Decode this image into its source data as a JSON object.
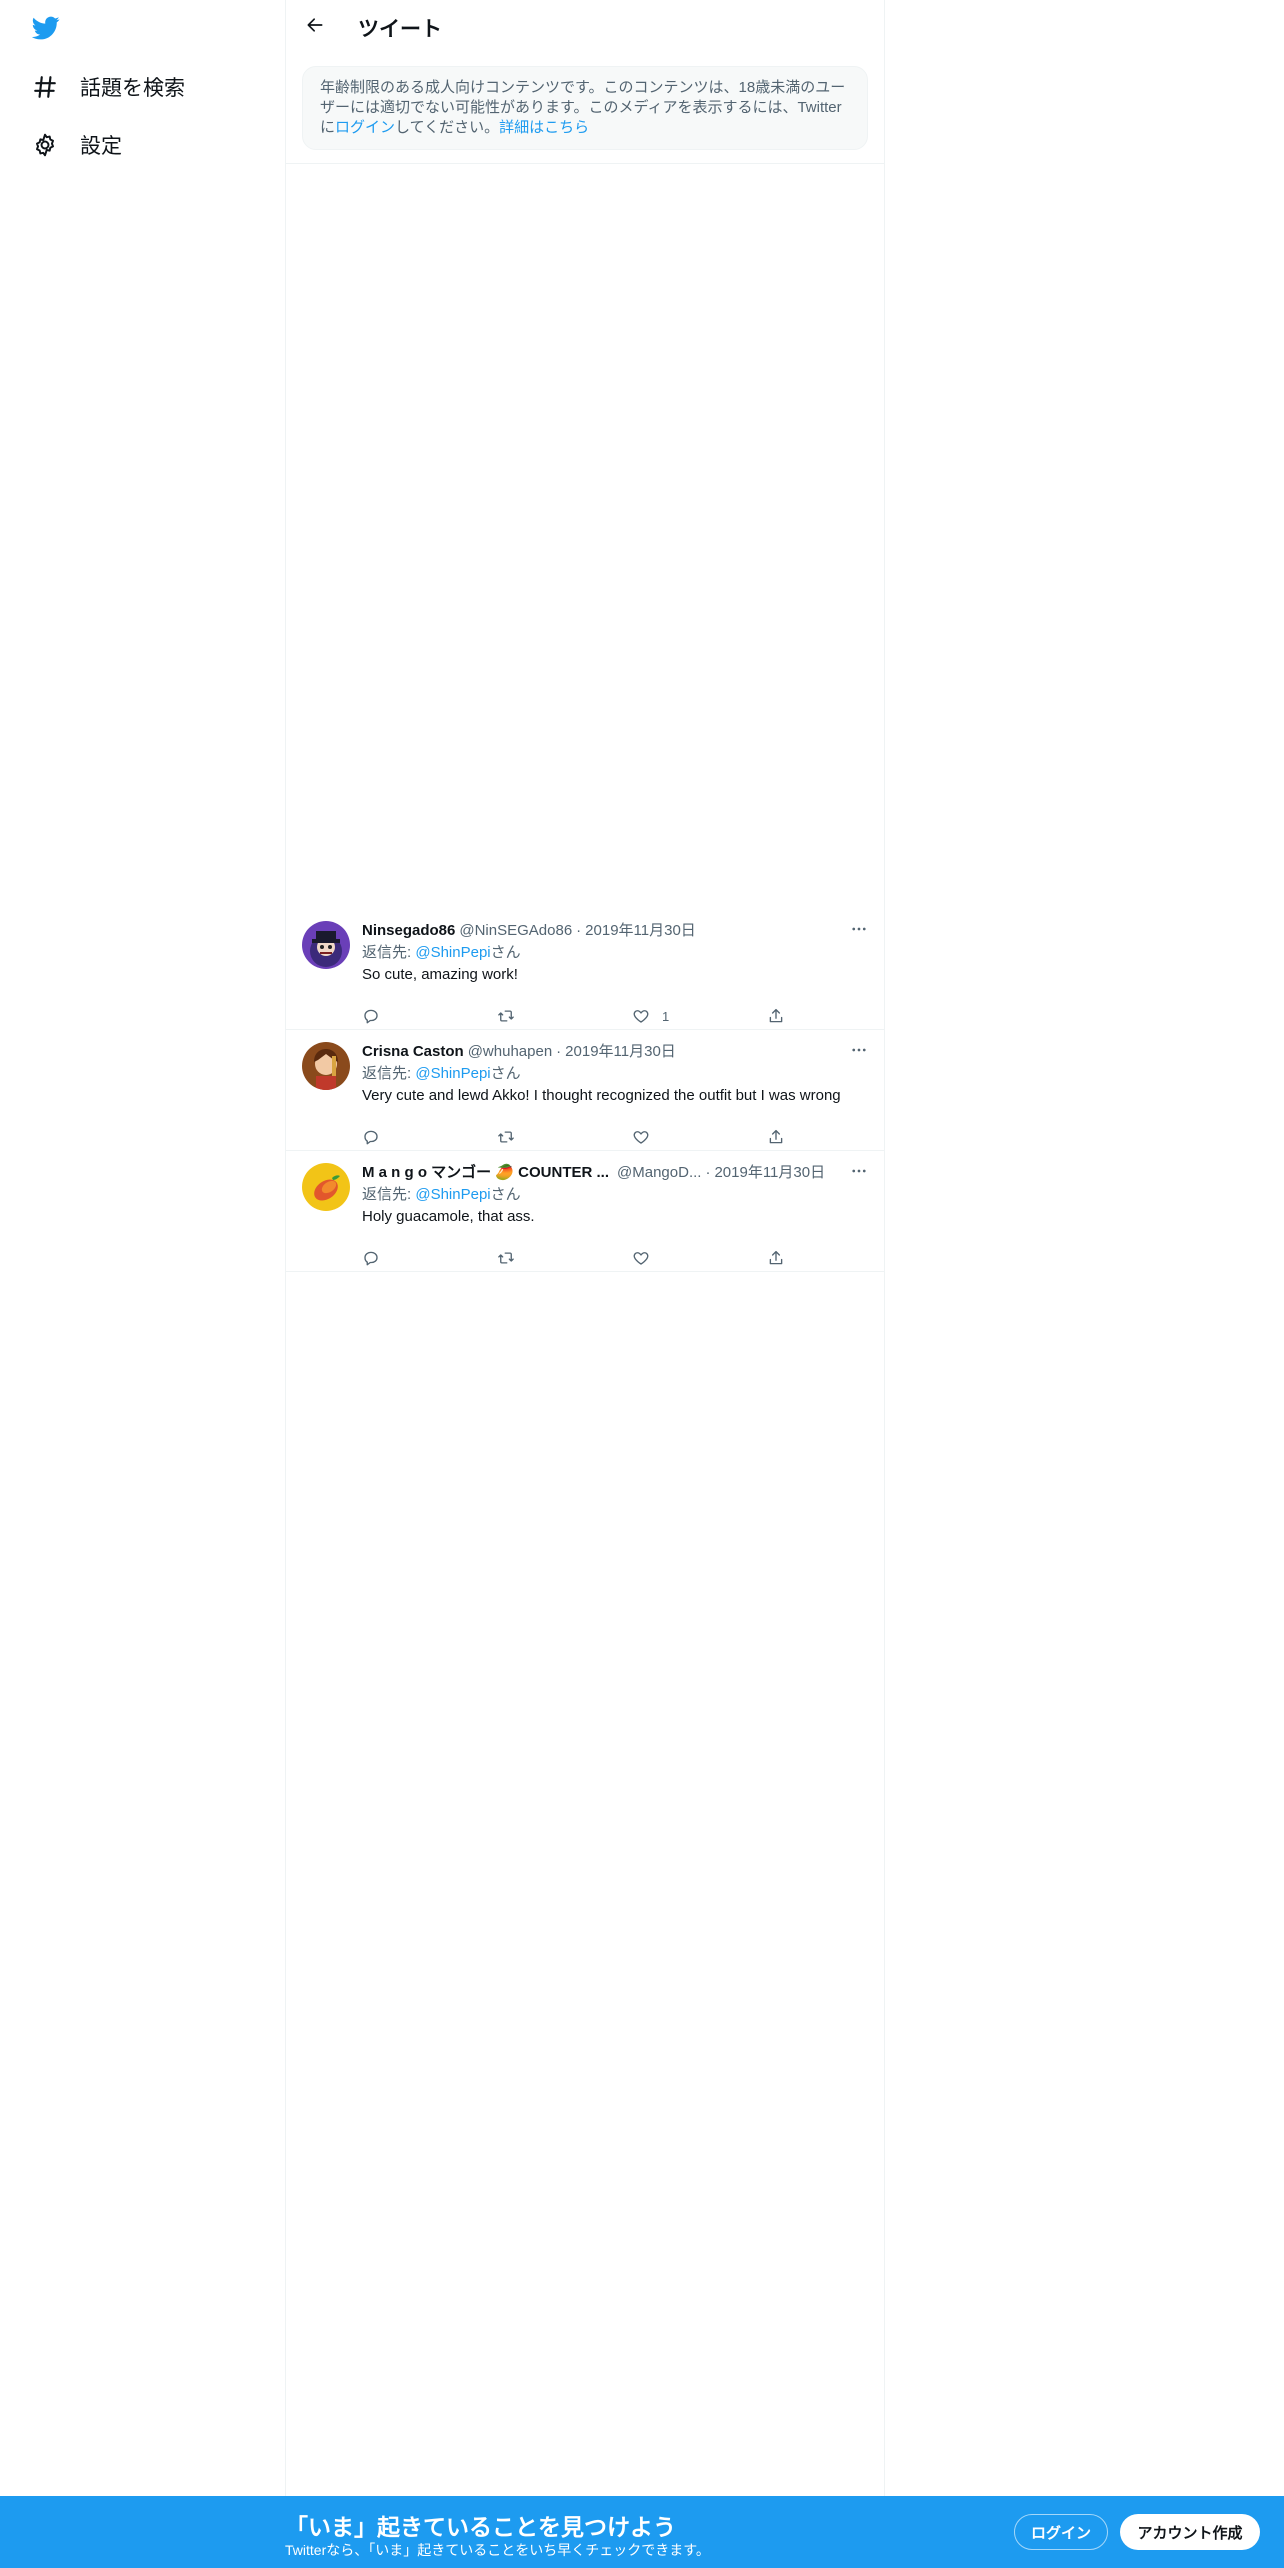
{
  "colors": {
    "brand": "#1d9bf0",
    "text_primary": "#0f1419",
    "text_secondary": "#536471",
    "border": "#eff3f4"
  },
  "sidebar": {
    "logo_icon": "twitter-bird-icon",
    "items": [
      {
        "icon": "hashtag-icon",
        "label": "話題を検索"
      },
      {
        "icon": "gear-icon",
        "label": "設定"
      }
    ]
  },
  "header": {
    "back_icon": "arrow-left-icon",
    "title": "ツイート"
  },
  "warning": {
    "text_before": "年齢制限のある成人向けコンテンツです。このコンテンツは、18歳未満のユーザーには適切でない可能性があります。このメディアを表示するには、Twitterに",
    "login_link": "ログイン",
    "text_middle": "してください。",
    "details_link": "詳細はこちら"
  },
  "tweets": [
    {
      "name": "Ninsegado86",
      "handle": "@NinSEGAdo86",
      "separator": "·",
      "date": "2019年11月30日",
      "reply_prefix": "返信先: ",
      "reply_mention": "@ShinPepi",
      "reply_suffix": "さん",
      "text": "So cute, amazing work!",
      "like_count": "1"
    },
    {
      "name": "Crisna Caston",
      "handle": "@whuhapen",
      "separator": "·",
      "date": "2019年11月30日",
      "reply_prefix": "返信先: ",
      "reply_mention": "@ShinPepi",
      "reply_suffix": "さん",
      "text": "Very cute and lewd Akko! I thought recognized the outfit but I was wrong",
      "like_count": ""
    },
    {
      "name": "M a n g o マンゴー 🥭 COUNTER ...",
      "handle": "@MangoD...",
      "separator": "·",
      "date": "2019年11月30日",
      "reply_prefix": "返信先: ",
      "reply_mention": "@ShinPepi",
      "reply_suffix": "さん",
      "text": "Holy guacamole, that ass.",
      "like_count": ""
    }
  ],
  "bottom_bar": {
    "title": "「いま」起きていることを見つけよう",
    "subtitle": "Twitterなら、「いま」起きていることをいち早くチェックできます。",
    "login_label": "ログイン",
    "signup_label": "アカウント作成"
  }
}
